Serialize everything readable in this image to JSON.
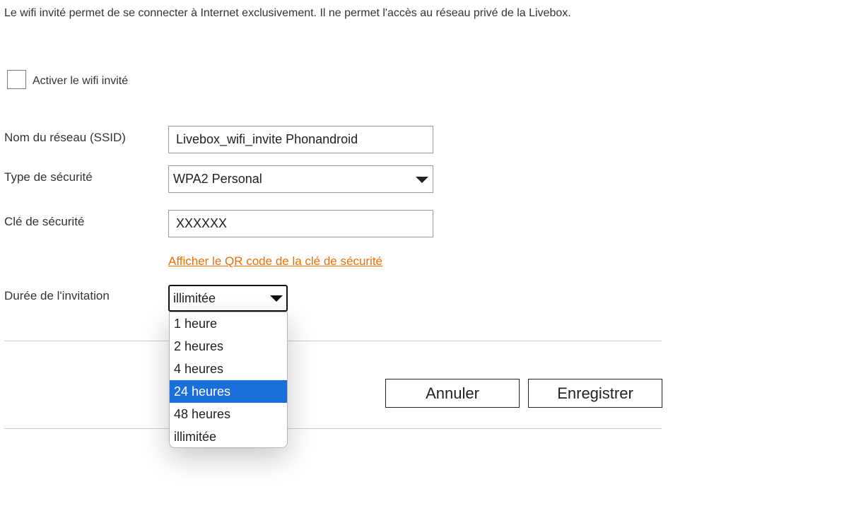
{
  "intro_text": "Le wifi invité permet de se connecter à Internet exclusivement. Il ne permet l'accès au réseau privé de la Livebox.",
  "guest_wifi": {
    "checkbox_label": "Activer le wifi invité",
    "checked": false
  },
  "form": {
    "ssid": {
      "label": "Nom du réseau (SSID)",
      "value": "Livebox_wifi_invite Phonandroid"
    },
    "security_type": {
      "label": "Type de sécurité",
      "value": "WPA2 Personal"
    },
    "security_key": {
      "label": "Clé de sécurité",
      "value": "XXXXXX"
    },
    "qr_link": "Afficher le QR code de la clé de sécurité",
    "duration": {
      "label": "Durée de l'invitation",
      "value": "illimitée",
      "options": [
        "1 heure",
        "2 heures",
        "4 heures",
        "24 heures",
        "48 heures",
        "illimitée"
      ],
      "highlighted": "24 heures"
    }
  },
  "buttons": {
    "cancel": "Annuler",
    "save": "Enregistrer"
  },
  "colors": {
    "link": "#f16e00",
    "highlight": "#1a6fdb",
    "text": "#333333"
  }
}
